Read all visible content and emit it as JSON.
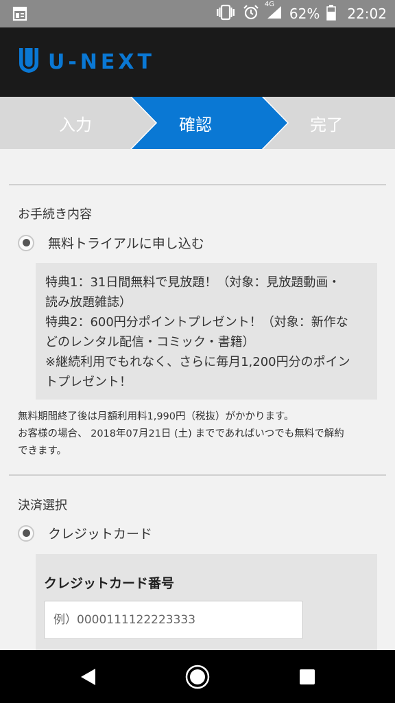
{
  "status_bar": {
    "network": "4G",
    "battery": "62%",
    "time": "22:02",
    "icons": [
      "notification-icon",
      "vibrate-icon",
      "alarm-icon",
      "signal-icon",
      "battery-icon"
    ]
  },
  "header": {
    "logo_text": "U-NEXT",
    "brand_color": "#0a78d4"
  },
  "steps": {
    "items": [
      {
        "label": "入力",
        "active": false
      },
      {
        "label": "確認",
        "active": true
      },
      {
        "label": "完了",
        "active": false
      }
    ],
    "active_color": "#0a78d4",
    "inactive_color": "#d8d8d8"
  },
  "procedure": {
    "title": "お手続き内容",
    "option_label": "無料トライアルに申し込む",
    "benefits": [
      "特典1：31日間無料で見放題！（対象：見放題動画・",
      "読み放題雑誌）",
      "特典2：600円分ポイントプレゼント！（対象：新作な",
      "どのレンタル配信・コミック・書籍）",
      "※継続利用でもれなく、さらに毎月1,200円分のポイン",
      "トプレゼント！"
    ],
    "notes": [
      "無料期間終了後は月額利用料1,990円（税抜）がかかります。",
      "お客様の場合、 2018年07月21日 (土) までであればいつでも無料で解約",
      "できます。"
    ]
  },
  "payment": {
    "title": "決済選択",
    "option_label": "クレジットカード",
    "card_number_label": "クレジットカード番号",
    "card_number_placeholder": "例）0000111122223333",
    "card_number_value": ""
  },
  "nav_bar": {
    "icons": [
      "back-icon",
      "home-icon",
      "recents-icon"
    ]
  }
}
